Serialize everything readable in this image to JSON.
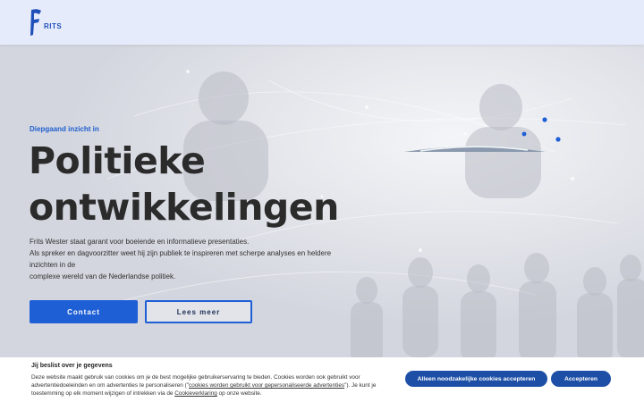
{
  "header": {
    "logo_text": "RITS",
    "logo_color": "#1f4fb8"
  },
  "hero": {
    "eyebrow": "Diepgaand inzicht in",
    "headline_line1": "Politieke",
    "headline_line2": "ontwikkelingen",
    "body_line1": "Frits Wester staat garant voor boeiende en informatieve presentaties.",
    "body_line2": "Als spreker en dagvoorzitter weet hij zijn publiek te inspireren met scherpe analyses en heldere inzichten in de",
    "body_line3": "complexe wereld van de Nederlandse politiek.",
    "primary_button": "Contact",
    "secondary_button": "Lees meer",
    "accent_color": "#1f5fd6"
  },
  "cookie": {
    "title": "Jij beslist over je gegevens",
    "text_part1": "Deze website maakt gebruik van cookies om je de best mogelijke gebruikerservaring te bieden. Cookies worden ook gebruikt voor advertentiedoeleinden en om advertenties te personaliseren (\"",
    "link1": "cookies worden gebruikt voor gepersonaliseerde advertenties",
    "text_part2": "\"). Je kunt je toestemming op elk moment wijzigen of intrekken via de ",
    "link2": "Cookieverklaring",
    "text_part3": " op onze website.",
    "btn_necessary": "Alleen noodzakelijke cookies accepteren",
    "btn_accept": "Accepteren",
    "button_color": "#1d4fa6"
  }
}
